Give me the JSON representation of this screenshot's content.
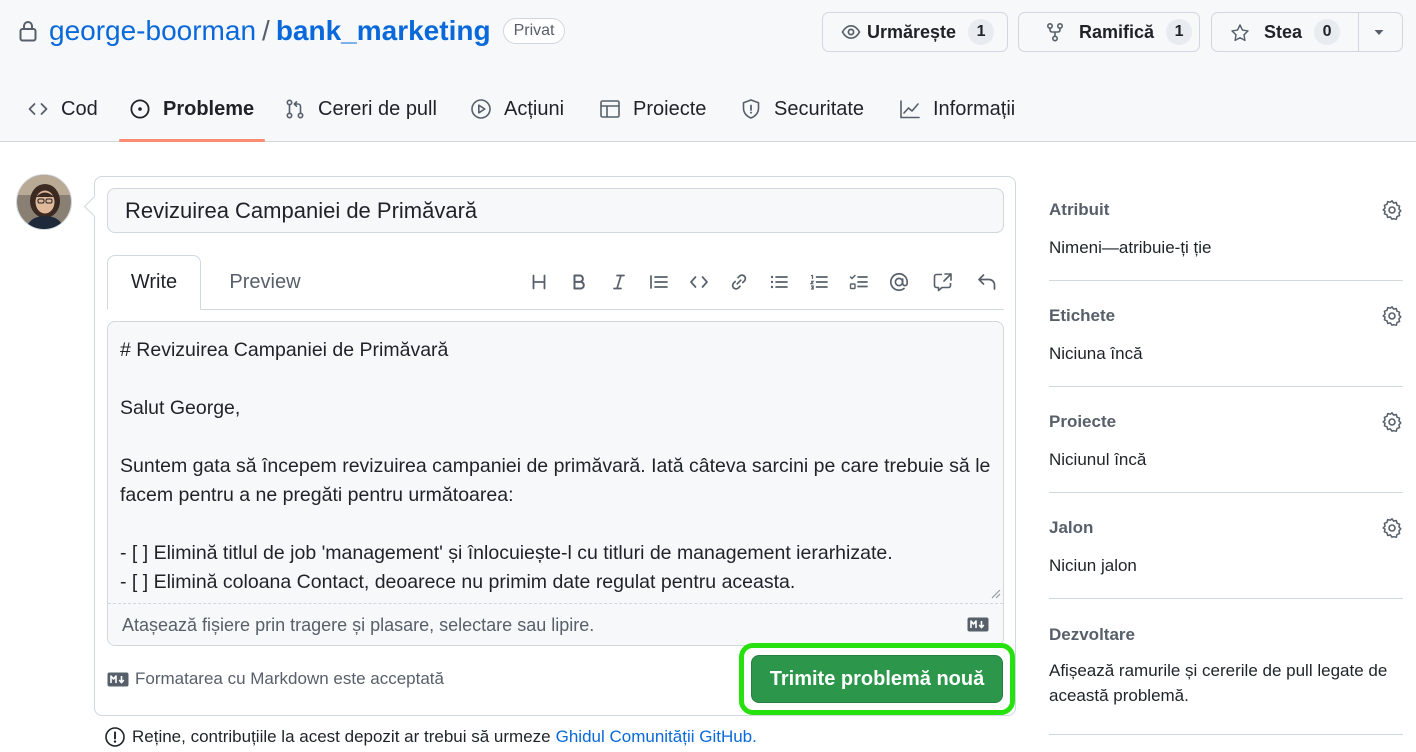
{
  "repo": {
    "owner": "george-boorman",
    "separator": "/",
    "name": "bank_marketing",
    "visibility": "Privat"
  },
  "header_buttons": {
    "watch": {
      "label": "Urmărește",
      "count": "1"
    },
    "fork": {
      "label": "Ramifică",
      "count": "1"
    },
    "star": {
      "label": "Stea",
      "count": "0"
    }
  },
  "nav_tabs": [
    {
      "label": "Cod",
      "icon": "code-icon"
    },
    {
      "label": "Probleme",
      "icon": "issue-opened-icon",
      "active": true
    },
    {
      "label": "Cereri de pull",
      "icon": "git-pull-request-icon"
    },
    {
      "label": "Acțiuni",
      "icon": "play-icon"
    },
    {
      "label": "Proiecte",
      "icon": "table-icon"
    },
    {
      "label": "Securitate",
      "icon": "shield-icon"
    },
    {
      "label": "Informații",
      "icon": "graph-icon"
    }
  ],
  "issue": {
    "title_value": "Revizuirea Campaniei de Primăvară",
    "tabs": {
      "write": "Write",
      "preview": "Preview"
    },
    "body_lines": [
      "# Revizuirea Campaniei de Primăvară",
      "",
      "Salut George,",
      "",
      "Suntem gata să începem revizuirea campaniei de primăvară. Iată câteva sarcini pe care trebuie să le facem pentru a ne pregăti pentru următoarea:",
      "",
      "- [ ] Elimină titlul de job 'management' și înlocuiește-l cu titluri de management ierarhizate.",
      "- [ ] Elimină coloana Contact, deoarece nu primim date regulat pentru aceasta."
    ],
    "attach_hint": "Atașează fișiere prin tragere și plasare, selectare sau lipire.",
    "markdown_note": "Formatarea cu Markdown este acceptată",
    "submit_label": "Trimite problemă nouă",
    "guide_prefix": "Reține, contribuțiile la acest depozit ar trebui să urmeze",
    "guide_link": "Ghidul Comunității GitHub."
  },
  "sidebar": {
    "assignees": {
      "heading": "Atribuit",
      "value": "Nimeni—atribuie-ți ție"
    },
    "labels": {
      "heading": "Etichete",
      "value": "Niciuna încă"
    },
    "projects": {
      "heading": "Proiecte",
      "value": "Niciunul încă"
    },
    "milestone": {
      "heading": "Jalon",
      "value": "Niciun jalon"
    },
    "development": {
      "heading": "Dezvoltare",
      "value": "Afișează ramurile și cererile de pull legate de această problemă."
    }
  },
  "colors": {
    "link": "#0969da",
    "submit_green": "#2c974b",
    "highlight_ring": "#27e10e",
    "active_tab_underline": "#fd8c73"
  }
}
